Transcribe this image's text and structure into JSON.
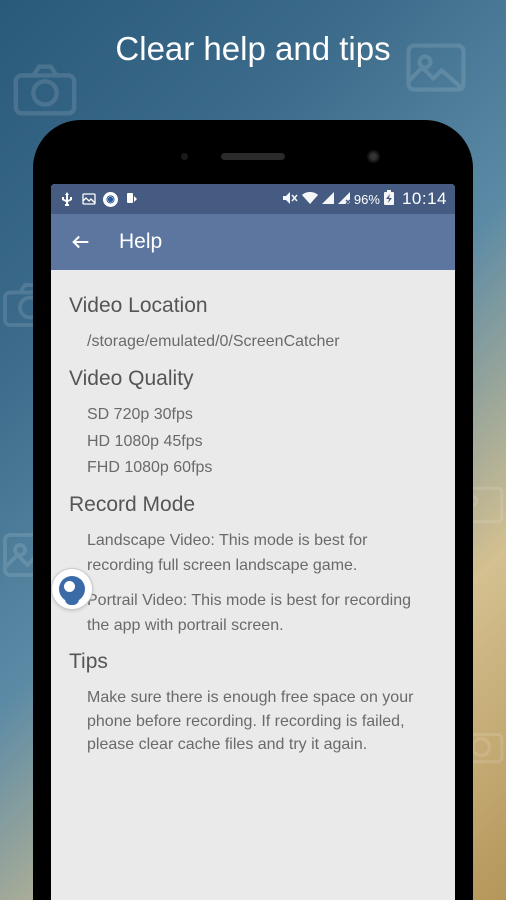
{
  "marketing": {
    "title": "Clear help and tips"
  },
  "statusbar": {
    "battery_pct": "96%",
    "time": "10:14"
  },
  "appbar": {
    "title": "Help"
  },
  "sections": {
    "video_location": {
      "title": "Video Location",
      "path": "/storage/emulated/0/ScreenCatcher"
    },
    "video_quality": {
      "title": "Video Quality",
      "opt1": "SD 720p 30fps",
      "opt2": "HD 1080p 45fps",
      "opt3": "FHD 1080p 60fps"
    },
    "record_mode": {
      "title": "Record Mode",
      "landscape": "Landscape Video: This mode is best for recording full screen landscape game.",
      "portrait": "Portrail Video: This mode is best for recording the app with portrail screen."
    },
    "tips": {
      "title": "Tips",
      "body": "Make sure there is enough free space on your phone before recording. If recording is failed, please clear cache files and try it again."
    }
  }
}
